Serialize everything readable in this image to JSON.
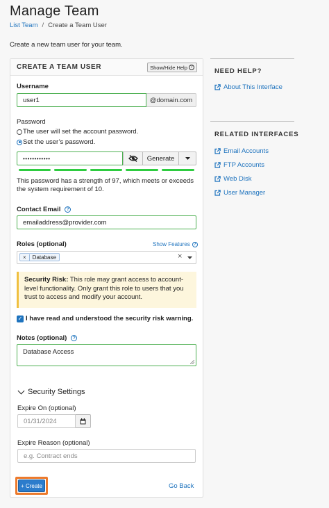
{
  "page": {
    "title": "Manage Team",
    "breadcrumb": {
      "parent": "List Team",
      "separator": "/",
      "current": "Create a Team User"
    },
    "intro": "Create a new team user for your team."
  },
  "panel": {
    "title": "CREATE A TEAM USER",
    "help_toggle": "Show/Hide Help",
    "username": {
      "label": "Username",
      "value": "user1",
      "suffix": "@domain.com"
    },
    "password": {
      "label": "Password",
      "option_user_sets": "The user will set the account password.",
      "option_set_now": "Set the user’s password.",
      "selected": "set_now",
      "value": "••••••••••••",
      "generate_label": "Generate",
      "strength_text": "This password has a strength of 97, which meets or exceeds the system requirement of 10.",
      "strength": 97
    },
    "contact_email": {
      "label": "Contact Email",
      "value": "emailaddress@provider.com"
    },
    "roles": {
      "label": "Roles (optional)",
      "show_features": "Show Features",
      "selected_tag": "Database",
      "clear_symbol": "×",
      "remove_symbol": "×"
    },
    "warning": {
      "strong": "Security Risk:",
      "text": " This role may grant access to account-level functionality. Only grant this role to users that you trust to access and modify your account."
    },
    "acknowledge": {
      "label": "I have read and understood the security risk warning.",
      "checked": true
    },
    "notes": {
      "label": "Notes (optional)",
      "value": "Database Access"
    },
    "security": {
      "title": "Security Settings",
      "expire_on_label": "Expire On (optional)",
      "expire_on_placeholder": "01/31/2024",
      "expire_reason_label": "Expire Reason (optional)",
      "expire_reason_placeholder": "e.g. Contract ends"
    },
    "actions": {
      "create": "+ Create",
      "go_back": "Go Back"
    }
  },
  "sidebar": {
    "help": {
      "heading": "NEED HELP?",
      "links": [
        "About This Interface"
      ]
    },
    "related": {
      "heading": "RELATED INTERFACES",
      "links": [
        "Email Accounts",
        "FTP Accounts",
        "Web Disk",
        "User Manager"
      ]
    }
  },
  "colors": {
    "accent": "#1e73be",
    "valid": "#4caf50",
    "focus_outline": "#ec7a2c",
    "warning_bg": "#fdf6dd"
  }
}
